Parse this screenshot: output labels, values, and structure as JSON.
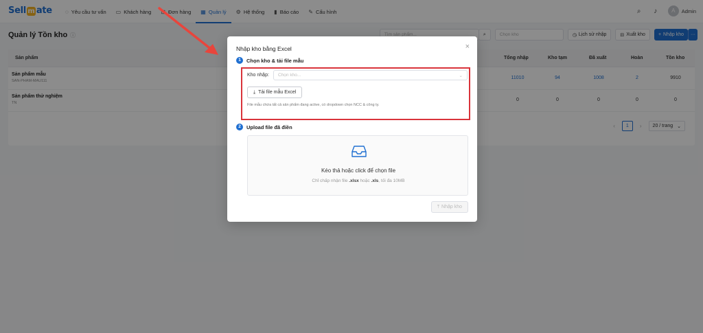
{
  "app": {
    "logo_text_left": "Sell",
    "logo_text_mid": "m",
    "logo_text_right": "ate"
  },
  "nav": {
    "items": [
      {
        "label": "Yêu cầu tư vấn",
        "icon": "chat-icon"
      },
      {
        "label": "Khách hàng",
        "icon": "id-card-icon"
      },
      {
        "label": "Đơn hàng",
        "icon": "cart-icon"
      },
      {
        "label": "Quản lý",
        "icon": "grid-icon"
      },
      {
        "label": "Hệ thống",
        "icon": "gear-icon"
      },
      {
        "label": "Báo cáo",
        "icon": "bar-chart-icon"
      },
      {
        "label": "Cấu hình",
        "icon": "wrench-icon"
      }
    ],
    "active_index": 3
  },
  "user": {
    "avatar_letter": "A",
    "name": "Admin"
  },
  "page": {
    "title": "Quản lý Tồn kho"
  },
  "toolbar": {
    "search_placeholder": "Tìm sản phẩm...",
    "warehouse_placeholder": "Chọn kho",
    "history_label": "Lịch sử nhập",
    "export_label": "Xuất kho",
    "import_label": "Nhập kho"
  },
  "table": {
    "headers": {
      "product": "Sản phẩm",
      "total_in": "Tổng nhập",
      "temp": "Kho tạm",
      "out": "Đã xuất",
      "returned": "Hoàn",
      "stock": "Tồn kho"
    },
    "rows": [
      {
        "name": "Sản phẩm mẫu",
        "sku": "SAN-PHAM-MAU111",
        "total_in": "11010",
        "temp": "94",
        "out": "1008",
        "returned": "2",
        "stock": "9910"
      },
      {
        "name": "Sản phẩm thử nghiệm",
        "sku": "TN",
        "total_in": "0",
        "temp": "0",
        "out": "0",
        "returned": "0",
        "stock": "0"
      }
    ],
    "pagination": {
      "current_page": "1",
      "page_size": "20 / trang"
    }
  },
  "modal": {
    "title": "Nhập kho bằng Excel",
    "step1": {
      "number": "1",
      "label": "Chọn kho & tải file mẫu",
      "warehouse_label": "Kho nhập:",
      "warehouse_placeholder": "Chọn kho...",
      "download_label": "Tải file mẫu Excel",
      "hint": "File mẫu chứa tất cả sản phẩm đang active, có dropdown chọn NCC & công ty."
    },
    "step2": {
      "number": "2",
      "label": "Upload file đã điền",
      "drop_main": "Kéo thả hoặc click để chọn file",
      "drop_sub_prefix": "Chỉ chấp nhận file ",
      "drop_sub_xlsx": ".xlsx",
      "drop_sub_mid": " hoặc ",
      "drop_sub_xls": ".xls",
      "drop_sub_suffix": ", tối đa 10MB"
    },
    "submit_label": "Nhập kho"
  },
  "colors": {
    "brand": "#1f6fd1",
    "highlight": "#d9333a",
    "arrow": "#e8453c"
  }
}
